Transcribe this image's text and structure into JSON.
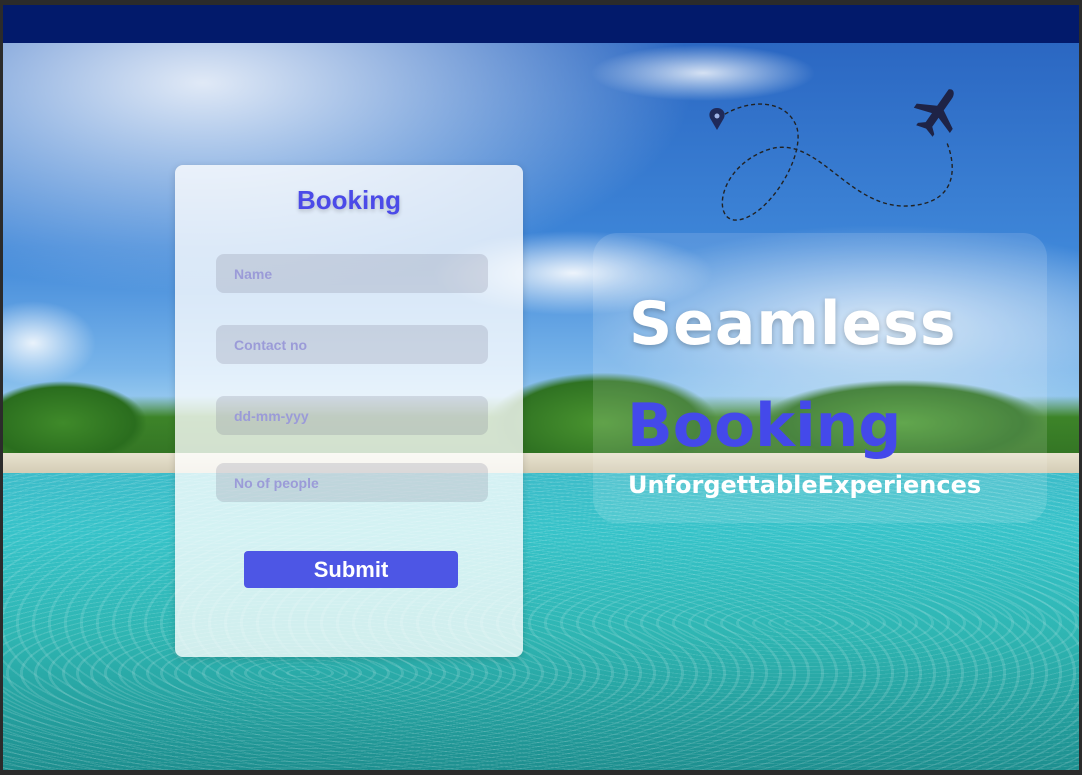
{
  "form": {
    "title": "Booking",
    "fields": [
      {
        "placeholder": "Name"
      },
      {
        "placeholder": "Contact no"
      },
      {
        "placeholder": "dd-mm-yyy"
      },
      {
        "placeholder": "No of people"
      }
    ],
    "submit_label": "Submit"
  },
  "hero": {
    "line1": "Seamless",
    "line2": "Booking",
    "line3": "UnforgettableExperiences"
  },
  "icons": {
    "decoration": [
      "location-pin-icon",
      "airplane-icon"
    ]
  },
  "colors": {
    "topbar": "#021a6b",
    "accent": "#4b4ae8",
    "button": "#4d56e5"
  }
}
